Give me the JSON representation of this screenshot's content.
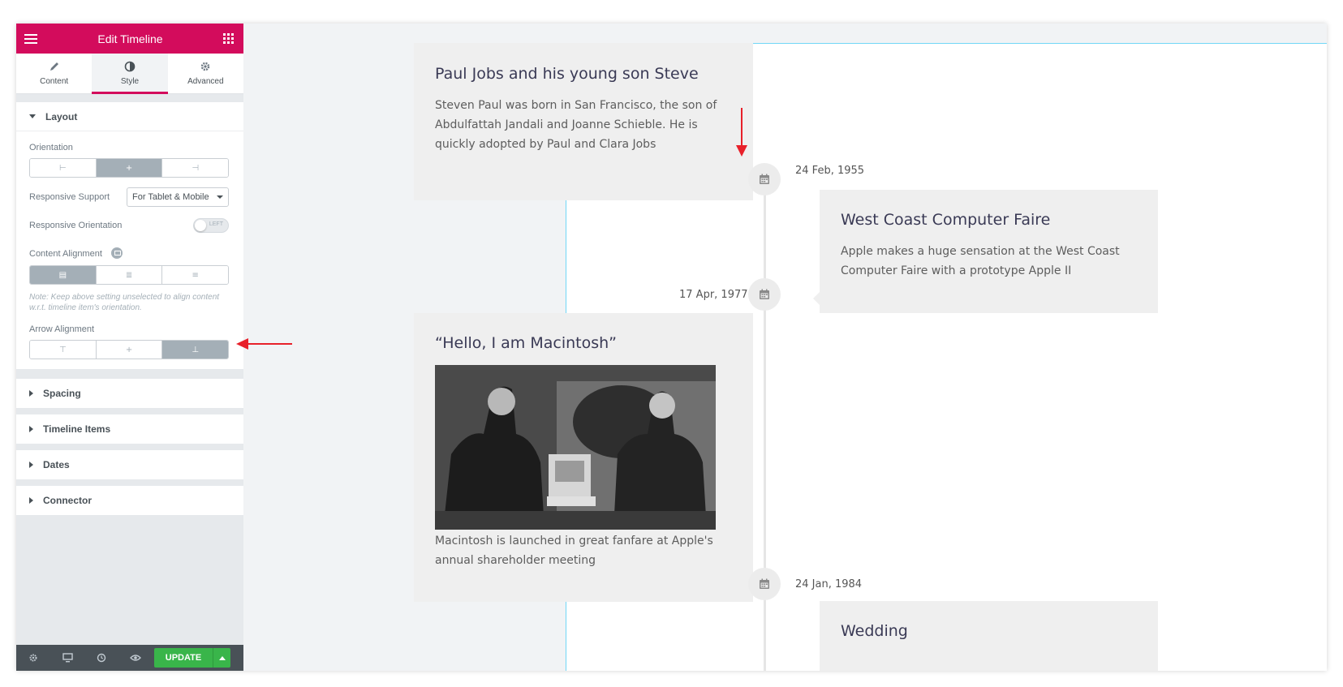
{
  "editor": {
    "title": "Edit Timeline",
    "tabs": [
      {
        "label": "Content",
        "icon": "pencil-icon"
      },
      {
        "label": "Style",
        "icon": "half-circle-icon"
      },
      {
        "label": "Advanced",
        "icon": "gear-icon"
      }
    ],
    "active_tab": "Style",
    "layout_section": {
      "title": "Layout",
      "orientation_label": "Orientation",
      "orientation_options": [
        "left",
        "center",
        "right"
      ],
      "orientation_selected": "center",
      "responsive_support_label": "Responsive Support",
      "responsive_support_value": "For Tablet & Mobile",
      "responsive_orientation_label": "Responsive Orientation",
      "responsive_orientation_toggle": "LEFT",
      "content_alignment_label": "Content Alignment",
      "content_alignment_selected": "left",
      "note": "Note: Keep above setting unselected to align content w.r.t. timeline item's orientation.",
      "arrow_alignment_label": "Arrow Alignment",
      "arrow_alignment_selected": "bottom"
    },
    "collapsed_sections": [
      "Spacing",
      "Timeline Items",
      "Dates",
      "Connector"
    ],
    "footer": {
      "update_label": "UPDATE",
      "icons": [
        "settings-icon",
        "responsive-mode-icon",
        "history-icon",
        "preview-icon"
      ]
    }
  },
  "timeline": {
    "items": [
      {
        "title": "Paul Jobs and his young son Steve",
        "text": "Steven Paul was born in San Francisco, the son of Abdulfattah Jandali and Joanne Schieble. He is quickly adopted by Paul and Clara Jobs",
        "date": "24 Feb, 1955"
      },
      {
        "title": "West Coast Computer Faire",
        "text": "Apple makes a huge sensation at the West Coast Computer Faire with a prototype Apple II",
        "date": "17 Apr, 1977"
      },
      {
        "title": "“Hello, I am Macintosh”",
        "text": "Macintosh is launched in great fanfare at Apple's annual shareholder meeting",
        "date": "24 Jan, 1984"
      },
      {
        "title": "Wedding",
        "text": "",
        "date": ""
      }
    ]
  },
  "colors": {
    "brand": "#d30c5c",
    "update_green": "#39b54a",
    "annotation_red": "#e8202a",
    "card_bg": "#efefef"
  }
}
